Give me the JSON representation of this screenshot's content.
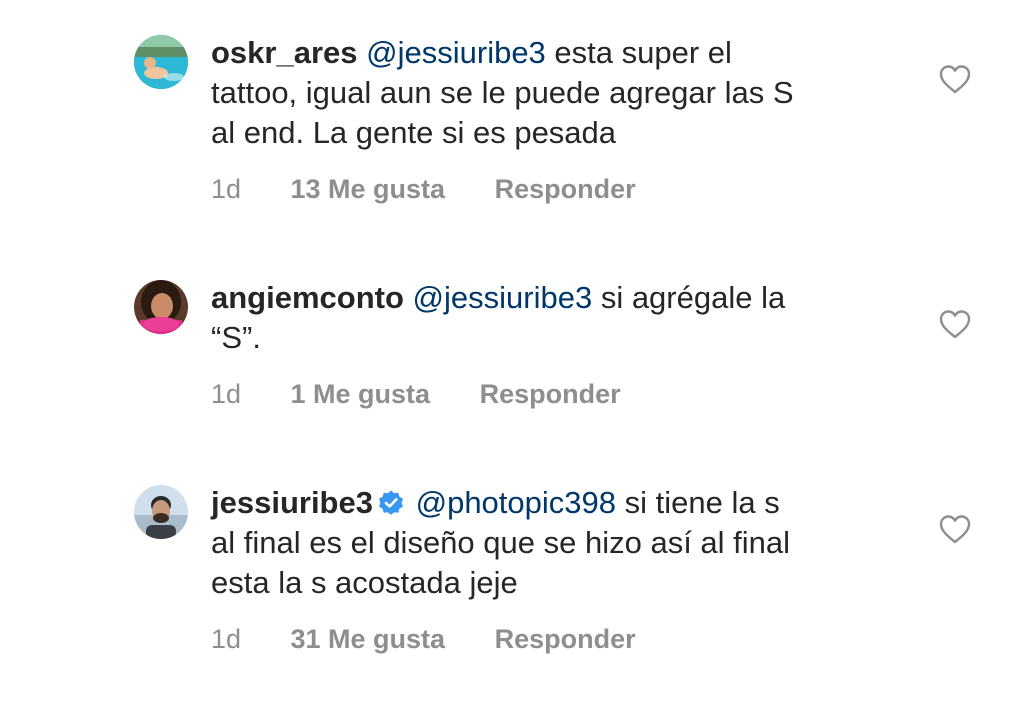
{
  "comments": [
    {
      "username": "oskr_ares",
      "mention": "@jessiuribe3",
      "text_line1": " esta super el",
      "text_line2": "tattoo, igual aun se le puede agregar las S",
      "text_line3": "al end. La gente si es pesada",
      "time": "1d",
      "likes": "13 Me gusta",
      "reply": "Responder",
      "avatar": "pool-photo",
      "liked": false
    },
    {
      "username": "angiemconto",
      "mention": "@jessiuribe3",
      "text_line1": " si agrégale la",
      "text_line2": "“S”.",
      "time": "1d",
      "likes": "1 Me gusta",
      "reply": "Responder",
      "avatar": "woman-portrait",
      "liked": false
    },
    {
      "username": "jessiuribe3",
      "verified": true,
      "verified_icon": "verified-badge-icon",
      "mention": "@photopic398",
      "text_line1": " si tiene la s",
      "text_line2": "al final es el diseño que se hizo así al final",
      "text_line3": "esta la s acostada jeje",
      "time": "1d",
      "likes": "31 Me gusta",
      "reply": "Responder",
      "avatar": "man-portrait",
      "liked": false
    }
  ],
  "icons": {
    "like": "heart-outline-icon"
  },
  "colors": {
    "text": "#262626",
    "mention": "#00376b",
    "secondary": "#8e8e8e",
    "verified": "#3897f0"
  }
}
